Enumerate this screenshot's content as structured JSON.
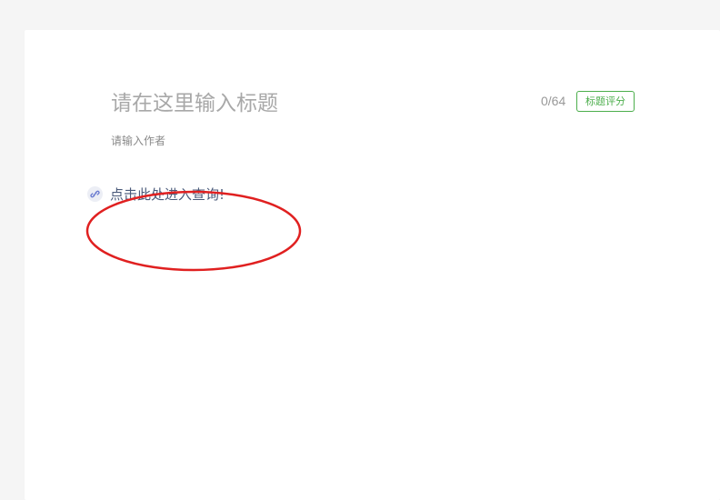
{
  "editor": {
    "title_placeholder": "请在这里输入标题",
    "title_counter": "0/64",
    "title_score_label": "标题评分",
    "author_placeholder": "请输入作者"
  },
  "content": {
    "link_icon": "link-icon",
    "link_text": "点击此处进入查询!"
  },
  "annotation": {
    "color": "#e02020",
    "shape": "ellipse"
  },
  "colors": {
    "page_background": "#f5f5f5",
    "card_background": "#ffffff",
    "accent_green": "#4cae4c",
    "link_text": "#4a5a7a"
  }
}
